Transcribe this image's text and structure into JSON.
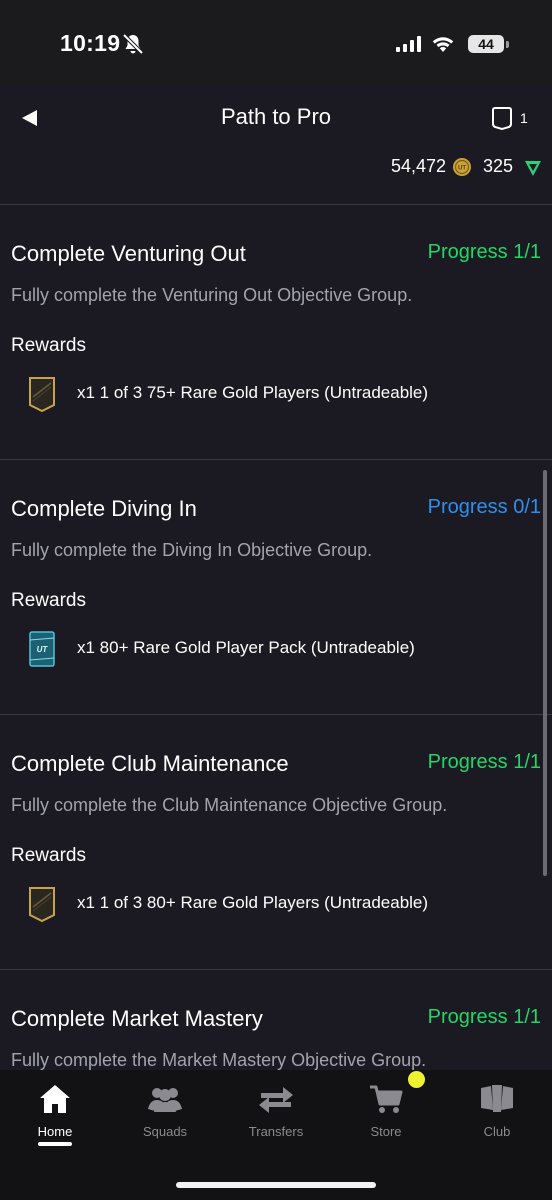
{
  "status_bar": {
    "time": "10:19",
    "battery": "44"
  },
  "header": {
    "title": "Path to Pro",
    "card_count": "1",
    "coins": "54,472",
    "points": "325"
  },
  "objectives": [
    {
      "title": "Complete Venturing Out",
      "progress": "Progress 1/1",
      "progress_state": "complete",
      "description": "Fully complete the Venturing Out Objective Group.",
      "rewards_label": "Rewards",
      "reward": "x1 1 of 3 75+ Rare Gold Players (Untradeable)",
      "reward_icon": "player-pick-icon"
    },
    {
      "title": "Complete Diving In",
      "progress": "Progress 0/1",
      "progress_state": "incomplete",
      "description": "Fully complete the Diving In Objective Group.",
      "rewards_label": "Rewards",
      "reward": "x1 80+ Rare Gold Player Pack (Untradeable)",
      "reward_icon": "pack-icon"
    },
    {
      "title": "Complete Club Maintenance",
      "progress": "Progress 1/1",
      "progress_state": "complete",
      "description": "Fully complete the Club Maintenance Objective Group.",
      "rewards_label": "Rewards",
      "reward": "x1 1 of 3 80+ Rare Gold Players (Untradeable)",
      "reward_icon": "player-pick-icon"
    },
    {
      "title": "Complete Market Mastery",
      "progress": "Progress 1/1",
      "progress_state": "complete",
      "description": "Fully complete the Market Mastery Objective Group."
    }
  ],
  "tabs": [
    {
      "label": "Home",
      "icon": "home-icon",
      "active": true
    },
    {
      "label": "Squads",
      "icon": "squads-icon"
    },
    {
      "label": "Transfers",
      "icon": "transfers-icon"
    },
    {
      "label": "Store",
      "icon": "cart-icon"
    },
    {
      "label": "Club",
      "icon": "club-icon"
    }
  ],
  "colors": {
    "background": "#1b1a22",
    "progress_complete": "#23d565",
    "progress_incomplete": "#2c8ff2",
    "notification": "#eef331"
  }
}
